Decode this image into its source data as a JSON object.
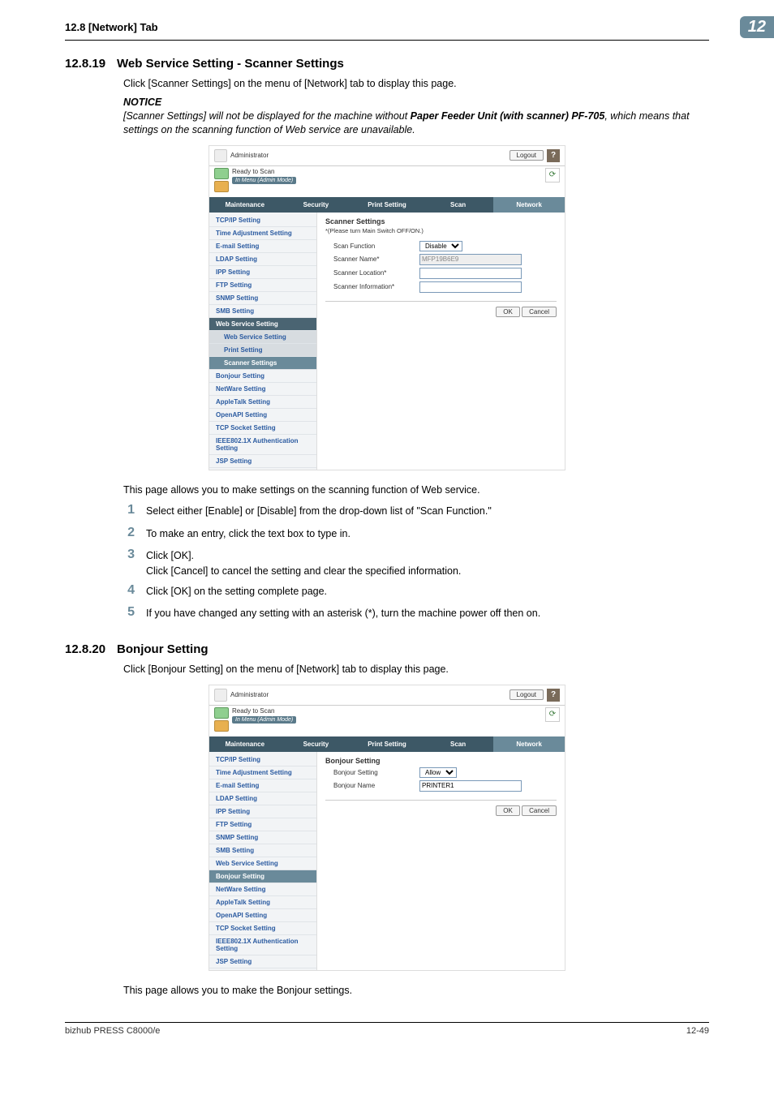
{
  "page_header": {
    "left": "12.8     [Network] Tab",
    "badge": "12"
  },
  "section1": {
    "num": "12.8.19",
    "title": "Web Service Setting - Scanner Settings",
    "intro": "Click [Scanner Settings] on the menu of [Network] tab to display this page.",
    "notice_label": "NOTICE",
    "notice_text_pre": "[Scanner Settings] will not be displayed for the machine without ",
    "notice_text_bold": "Paper Feeder Unit (with scanner) PF-705",
    "notice_text_post": ", which means that settings on the scanning function of Web service are unavailable.",
    "after_img": "This page allows you to make settings on the scanning function of Web service.",
    "steps": {
      "s1": "Select either [Enable] or [Disable] from the drop-down list of \"Scan Function.\"",
      "s2": "To make an entry, click the text box to type in.",
      "s3a": "Click [OK].",
      "s3b": "Click [Cancel] to cancel the setting and clear the specified information.",
      "s4": "Click [OK] on the setting complete page.",
      "s5": "If you have changed any setting with an asterisk (*), turn the machine power off then on."
    }
  },
  "section2": {
    "num": "12.8.20",
    "title": "Bonjour Setting",
    "intro": "Click [Bonjour Setting] on the menu of [Network] tab to display this page.",
    "after_img": "This page allows you to make the Bonjour settings."
  },
  "app_common": {
    "admin": "Administrator",
    "status1": "Ready to Scan",
    "status2": "In Menu (Admin Mode)",
    "logout": "Logout",
    "help": "?",
    "tabs": {
      "t1": "Maintenance",
      "t2": "Security",
      "t3": "Print Setting",
      "t4": "Scan",
      "t5": "Network"
    },
    "ok": "OK",
    "cancel": "Cancel"
  },
  "app1": {
    "sidebar": {
      "tcpip": "TCP/IP Setting",
      "time": "Time Adjustment Setting",
      "email": "E-mail Setting",
      "ldap": "LDAP Setting",
      "ipp": "IPP Setting",
      "ftp": "FTP Setting",
      "snmp": "SNMP Setting",
      "smb": "SMB Setting",
      "websvc": "Web Service Setting",
      "websvc_sub": "Web Service Setting",
      "print": "Print Setting",
      "scanner": "Scanner Settings",
      "bonjour": "Bonjour Setting",
      "netware": "NetWare Setting",
      "appletalk": "AppleTalk Setting",
      "openapi": "OpenAPI Setting",
      "tcpsocket": "TCP Socket Setting",
      "ieee": "IEEE802.1X Authentication Setting",
      "jsp": "JSP Setting"
    },
    "content": {
      "title": "Scanner Settings",
      "note": "*(Please turn Main Switch OFF/ON.)",
      "f1_label": "Scan Function",
      "f1_value": "Disable",
      "f2_label": "Scanner Name*",
      "f2_value": "MFP19B6E9",
      "f3_label": "Scanner Location*",
      "f4_label": "Scanner Information*"
    }
  },
  "app2": {
    "sidebar": {
      "tcpip": "TCP/IP Setting",
      "time": "Time Adjustment Setting",
      "email": "E-mail Setting",
      "ldap": "LDAP Setting",
      "ipp": "IPP Setting",
      "ftp": "FTP Setting",
      "snmp": "SNMP Setting",
      "smb": "SMB Setting",
      "websvc": "Web Service Setting",
      "bonjour": "Bonjour Setting",
      "netware": "NetWare Setting",
      "appletalk": "AppleTalk Setting",
      "openapi": "OpenAPI Setting",
      "tcpsocket": "TCP Socket Setting",
      "ieee": "IEEE802.1X Authentication Setting",
      "jsp": "JSP Setting"
    },
    "content": {
      "title": "Bonjour Setting",
      "f1_label": "Bonjour Setting",
      "f1_value": "Allow",
      "f2_label": "Bonjour Name",
      "f2_value": "PRINTER1"
    }
  },
  "footer": {
    "left": "bizhub PRESS C8000/e",
    "right": "12-49"
  }
}
